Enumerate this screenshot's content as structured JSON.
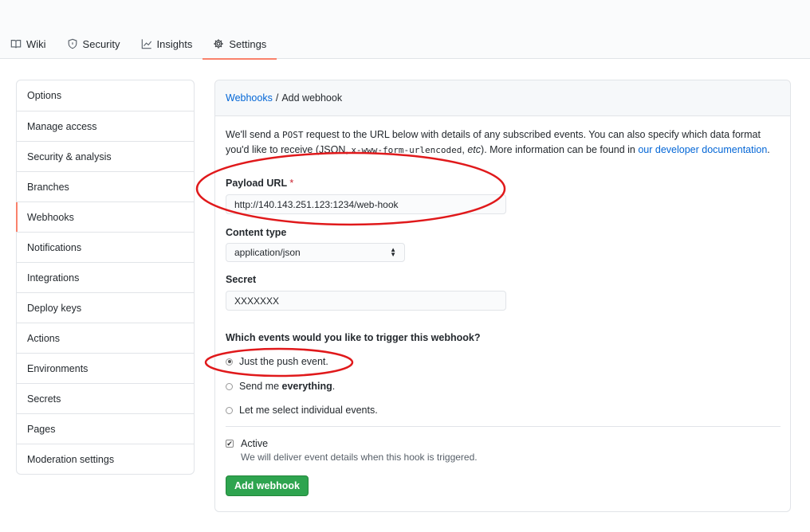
{
  "tabs": [
    {
      "label": "Wiki",
      "icon": "book-icon"
    },
    {
      "label": "Security",
      "icon": "shield-icon"
    },
    {
      "label": "Insights",
      "icon": "graph-icon"
    },
    {
      "label": "Settings",
      "icon": "gear-icon",
      "active": true
    }
  ],
  "sidebar": {
    "items": [
      {
        "label": "Options"
      },
      {
        "label": "Manage access"
      },
      {
        "label": "Security & analysis"
      },
      {
        "label": "Branches"
      },
      {
        "label": "Webhooks",
        "selected": true
      },
      {
        "label": "Notifications"
      },
      {
        "label": "Integrations"
      },
      {
        "label": "Deploy keys"
      },
      {
        "label": "Actions"
      },
      {
        "label": "Environments"
      },
      {
        "label": "Secrets"
      },
      {
        "label": "Pages"
      },
      {
        "label": "Moderation settings"
      }
    ]
  },
  "breadcrumb": {
    "parent": "Webhooks",
    "separator": "/",
    "current": "Add webhook"
  },
  "intro": {
    "part1": "We'll send a ",
    "post_code": "POST",
    "part2": " request to the URL below with details of any subscribed events. You can also specify which data format you'd like to receive (JSON, ",
    "form_code": "x-www-form-urlencoded",
    "part3": ", ",
    "etc": "etc",
    "part4": "). More information can be found in ",
    "link": "our developer documentation",
    "part5": "."
  },
  "form": {
    "payload_label": "Payload URL",
    "required_mark": "*",
    "payload_value": "http://140.143.251.123:1234/web-hook",
    "content_type_label": "Content type",
    "content_type_value": "application/json",
    "secret_label": "Secret",
    "secret_value": "XXXXXXX",
    "events_question": "Which events would you like to trigger this webhook?",
    "events": [
      {
        "label": "Just the push event.",
        "checked": true
      },
      {
        "label_prefix": "Send me ",
        "label_bold": "everything",
        "label_suffix": ".",
        "checked": false
      },
      {
        "label": "Let me select individual events.",
        "checked": false
      }
    ],
    "active_label": "Active",
    "active_checked": true,
    "active_note": "We will deliver event details when this hook is triggered.",
    "submit_label": "Add webhook"
  },
  "colors": {
    "accent_tab": "#f9826c",
    "link": "#0366d6",
    "primary_button": "#2ea44f",
    "annotation": "#e0191b"
  }
}
